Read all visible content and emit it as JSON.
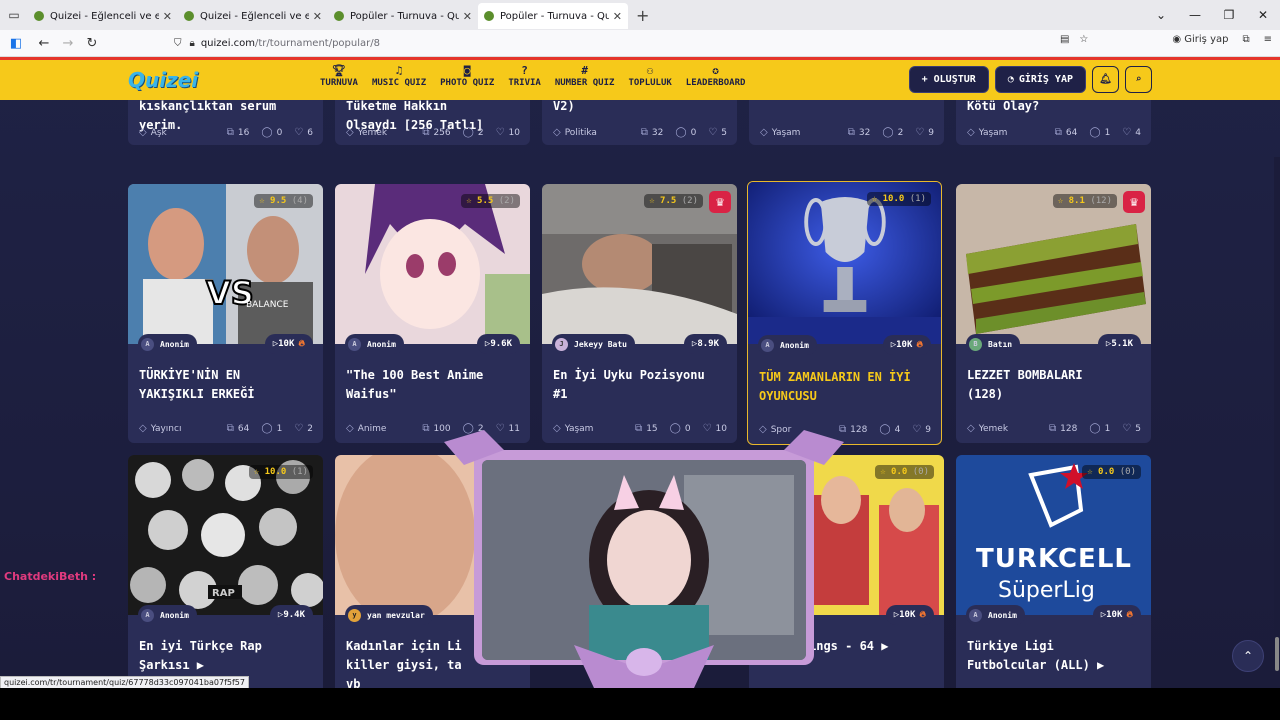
{
  "browser": {
    "tabs": [
      {
        "title": "Quizei - Eğlenceli ve etkileşimli"
      },
      {
        "title": "Quizei - Eğlenceli ve etkileşimli"
      },
      {
        "title": "Popüler - Turnuva - Quizei"
      },
      {
        "title": "Popüler - Turnuva - Quizei"
      }
    ],
    "url_host": "quizei.com",
    "url_path": "/tr/tournament/popular/8",
    "signin_label": "Giriş yap",
    "status_url": "quizei.com/tr/tournament/quiz/67778d33c097041ba07f5f57"
  },
  "site": {
    "logo": "Quizei",
    "menu": [
      {
        "icon": "trophy-icon",
        "label": "TURNUVA"
      },
      {
        "icon": "music-icon",
        "label": "MUSIC QUIZ"
      },
      {
        "icon": "camera-icon",
        "label": "PHOTO QUIZ"
      },
      {
        "icon": "question-icon",
        "label": "TRIVIA"
      },
      {
        "icon": "hash-icon",
        "label": "NUMBER QUIZ"
      },
      {
        "icon": "users-icon",
        "label": "TOPLULUK"
      },
      {
        "icon": "award-icon",
        "label": "LEADERBOARD"
      }
    ],
    "create_label": "+ OLUŞTUR",
    "login_label": "GİRİŞ YAP"
  },
  "top_cards": [
    {
      "title": "kıskançlıktan serum\nyerim.",
      "category": "Aşk",
      "count": "16",
      "comments": "0",
      "likes": "6"
    },
    {
      "title": "Tüketme Hakkın\nOlsaydı [256 Tatlı]",
      "category": "Yemek",
      "count": "256",
      "comments": "2",
      "likes": "10"
    },
    {
      "title": "V2)",
      "category": "Politika",
      "count": "32",
      "comments": "0",
      "likes": "5"
    },
    {
      "title": "",
      "category": "Yaşam",
      "count": "32",
      "comments": "2",
      "likes": "9"
    },
    {
      "title": "Kötü Olay?",
      "category": "Yaşam",
      "count": "64",
      "comments": "1",
      "likes": "4"
    }
  ],
  "cards_row1": [
    {
      "rating": "9.5",
      "rating_count": "(4)",
      "crown": false,
      "author": "Anonim",
      "author_initial": "A",
      "plays": "10K",
      "hot": true,
      "title": "TÜRKİYE'NİN EN\nYAKIŞIKLI ERKEĞİ",
      "category": "Yayıncı",
      "count": "64",
      "comments": "1",
      "likes": "2",
      "highlighted": false
    },
    {
      "rating": "5.5",
      "rating_count": "(2)",
      "crown": false,
      "author": "Anonim",
      "author_initial": "A",
      "plays": "9.6K",
      "hot": false,
      "title": "\"The 100 Best Anime\nWaifus\"",
      "category": "Anime",
      "count": "100",
      "comments": "2",
      "likes": "11",
      "highlighted": false
    },
    {
      "rating": "7.5",
      "rating_count": "(2)",
      "crown": true,
      "author": "Jekeyy Batu",
      "author_initial": "J",
      "plays": "8.9K",
      "hot": false,
      "title": "En İyi Uyku Pozisyonu\n#1",
      "category": "Yaşam",
      "count": "15",
      "comments": "0",
      "likes": "10",
      "highlighted": false
    },
    {
      "rating": "10.0",
      "rating_count": "(1)",
      "crown": false,
      "author": "Anonim",
      "author_initial": "A",
      "plays": "10K",
      "hot": true,
      "title": "TÜM ZAMANLARIN EN İYİ\nOYUNCUSU",
      "category": "Spor",
      "count": "128",
      "comments": "4",
      "likes": "9",
      "highlighted": true
    },
    {
      "rating": "8.1",
      "rating_count": "(12)",
      "crown": true,
      "author": "Batın",
      "author_initial": "B",
      "plays": "5.1K",
      "hot": false,
      "title": "LEZZET BOMBALARI\n(128)",
      "category": "Yemek",
      "count": "128",
      "comments": "1",
      "likes": "5",
      "highlighted": false
    }
  ],
  "cards_row2": [
    {
      "rating": "10.0",
      "rating_count": "(1)",
      "author": "Anonim",
      "author_initial": "A",
      "plays": "9.4K",
      "hot": false,
      "title": "En iyi Türkçe Rap\nŞarkısı ▶"
    },
    {
      "rating": "",
      "rating_count": "",
      "author": "yan mevzular",
      "author_initial": "y",
      "plays": "",
      "hot": false,
      "title": "Kadınlar için Li\nkiller giysi, ta\nvb"
    },
    {
      "rating": "",
      "rating_count": "",
      "author": "",
      "author_initial": "",
      "plays": "",
      "hot": false,
      "title": ""
    },
    {
      "rating": "0.0",
      "rating_count": "(0)",
      "author": "",
      "author_initial": "",
      "plays": "10K",
      "hot": true,
      "title": "ings - 64 ▶"
    },
    {
      "rating": "0.0",
      "rating_count": "(0)",
      "author": "Anonim",
      "author_initial": "A",
      "plays": "10K",
      "hot": true,
      "title": "Türkiye Ligi\nFutbolcular (ALL) ▶"
    }
  ],
  "thumb_texts": {
    "vs": "VS",
    "balance": "BALANCE",
    "rap": "RAP",
    "turkcell": "TURKCELL",
    "superlig": "SüperLig"
  },
  "stream": {
    "chat_user": "ChatdekiBeth :"
  },
  "colors": {
    "header": "#f6c91a",
    "bg": "#1f2245",
    "card": "#2a2d57",
    "accent": "#f6c91a",
    "crown": "#d92345"
  }
}
